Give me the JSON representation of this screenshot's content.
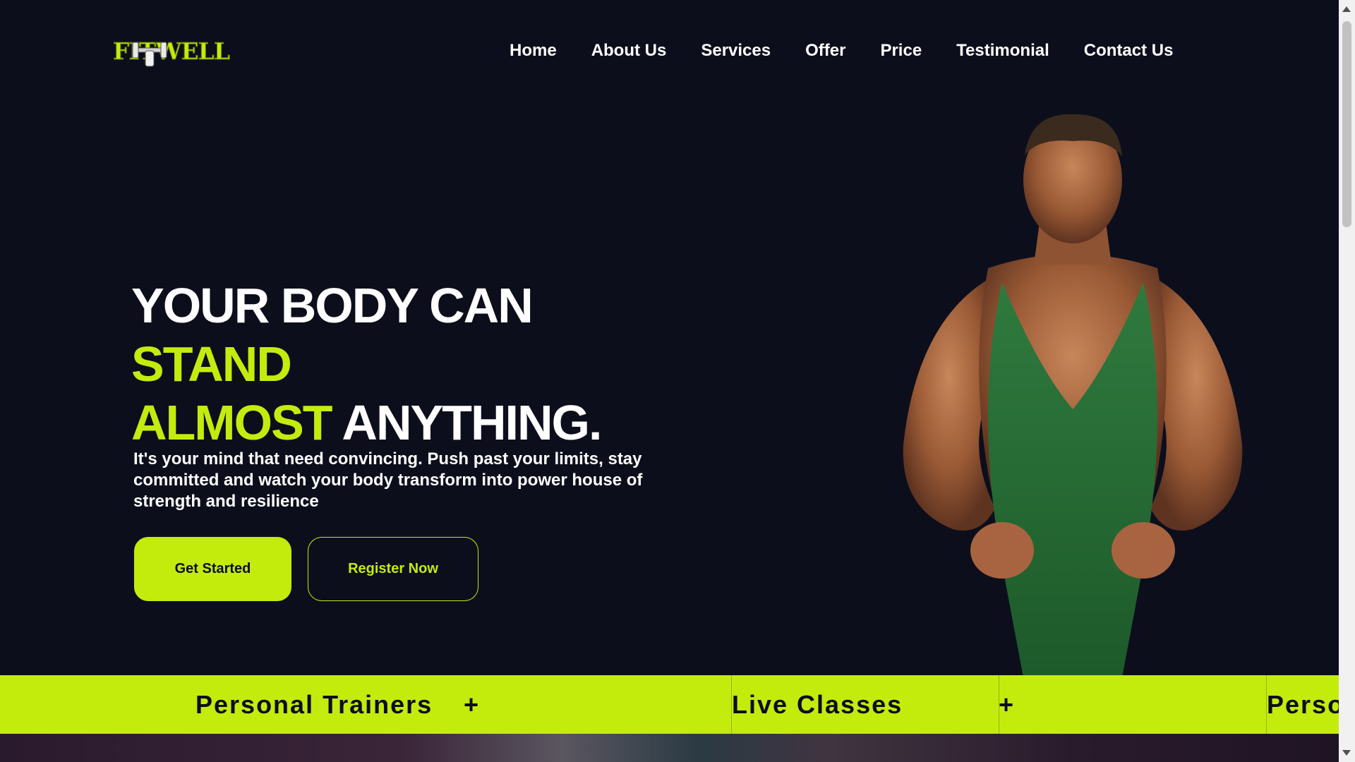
{
  "brand": {
    "logo_text": "FITWELL",
    "logo_icon": "dumbbell-icon"
  },
  "nav": {
    "items": [
      {
        "label": "Home"
      },
      {
        "label": "About Us"
      },
      {
        "label": "Services"
      },
      {
        "label": "Offer"
      },
      {
        "label": "Price"
      },
      {
        "label": "Testimonial"
      },
      {
        "label": "Contact Us"
      }
    ]
  },
  "hero": {
    "title_line1": "YOUR BODY CAN",
    "title_line2": "STAND",
    "title_line3_accent": "ALMOST",
    "title_line3_rest": "ANYTHING.",
    "subtitle": "It's your mind that need convincing. Push past your limits, stay committed and watch your body transform into power house of strength and resilience",
    "primary_button": "Get Started",
    "secondary_button": "Register Now",
    "image": "muscular-man-in-green-singlet"
  },
  "ticker": {
    "items": [
      "Personal Trainers",
      "Live Classes",
      "Perso"
    ],
    "separator": "+"
  },
  "colors": {
    "background": "#0c0e1c",
    "accent": "#c3ec0c",
    "text": "#ffffff"
  }
}
